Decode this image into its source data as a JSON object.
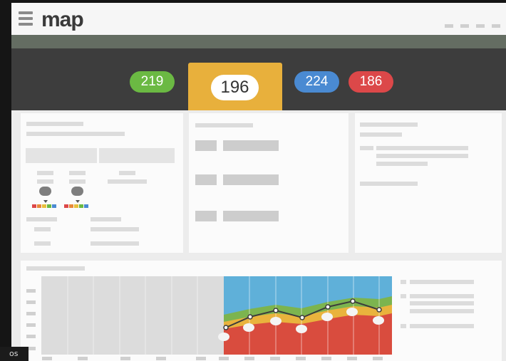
{
  "app": {
    "logo_text": "map"
  },
  "header": {
    "menu_icon": "hamburger-icon"
  },
  "scores": [
    {
      "label": "219",
      "color": "#6bb943"
    },
    {
      "label": "196",
      "color": "#e8b03c",
      "selected": true
    },
    {
      "label": "224",
      "color": "#4a8ad2"
    },
    {
      "label": "186",
      "color": "#dc4849"
    }
  ],
  "chart": {
    "bands": [
      "#d94c3e",
      "#e9b33d",
      "#7cb44f",
      "#5fb0d9"
    ],
    "trend_color": "#3c3c3c"
  },
  "corner": {
    "text": "os"
  }
}
